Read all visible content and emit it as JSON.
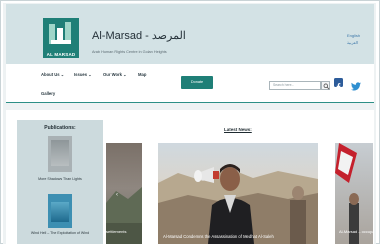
{
  "header": {
    "site_title": "Al-Marsad - المرصد",
    "tagline": "Arab Human Rights Centre in Golan Heights",
    "logo_text": "AL MARSAD",
    "lang_english": "English",
    "lang_arabic": "العربية"
  },
  "nav": {
    "items": [
      "About Us ⌄",
      "Issues ⌄",
      "Our Work ⌄",
      "Map",
      "Gallery"
    ],
    "donate_label": "Donate",
    "search_placeholder": "Search here..."
  },
  "sidebar": {
    "title": "Publications:",
    "books": [
      {
        "caption": "More Shadows Than Lights"
      },
      {
        "caption": "Wind Hell – The Exploitation of Wind"
      }
    ]
  },
  "news": {
    "title": "Latest News:",
    "slides": [
      {
        "caption": "settlements"
      },
      {
        "caption": "Al-Marsad Condemns the Assassination of Medhat Al-Saleh"
      },
      {
        "caption": "Al-Marsad – occupation s"
      }
    ]
  },
  "colors": {
    "brand_teal": "#1f7f77",
    "header_bg": "#d3e2e5",
    "sidebar_bg": "#ccdadd",
    "facebook_blue": "#2d5c9a",
    "twitter_blue": "#2f8fd0"
  },
  "icons": [
    "logo-icon",
    "search-icon",
    "facebook-icon",
    "twitter-icon",
    "chevron-left-icon"
  ]
}
